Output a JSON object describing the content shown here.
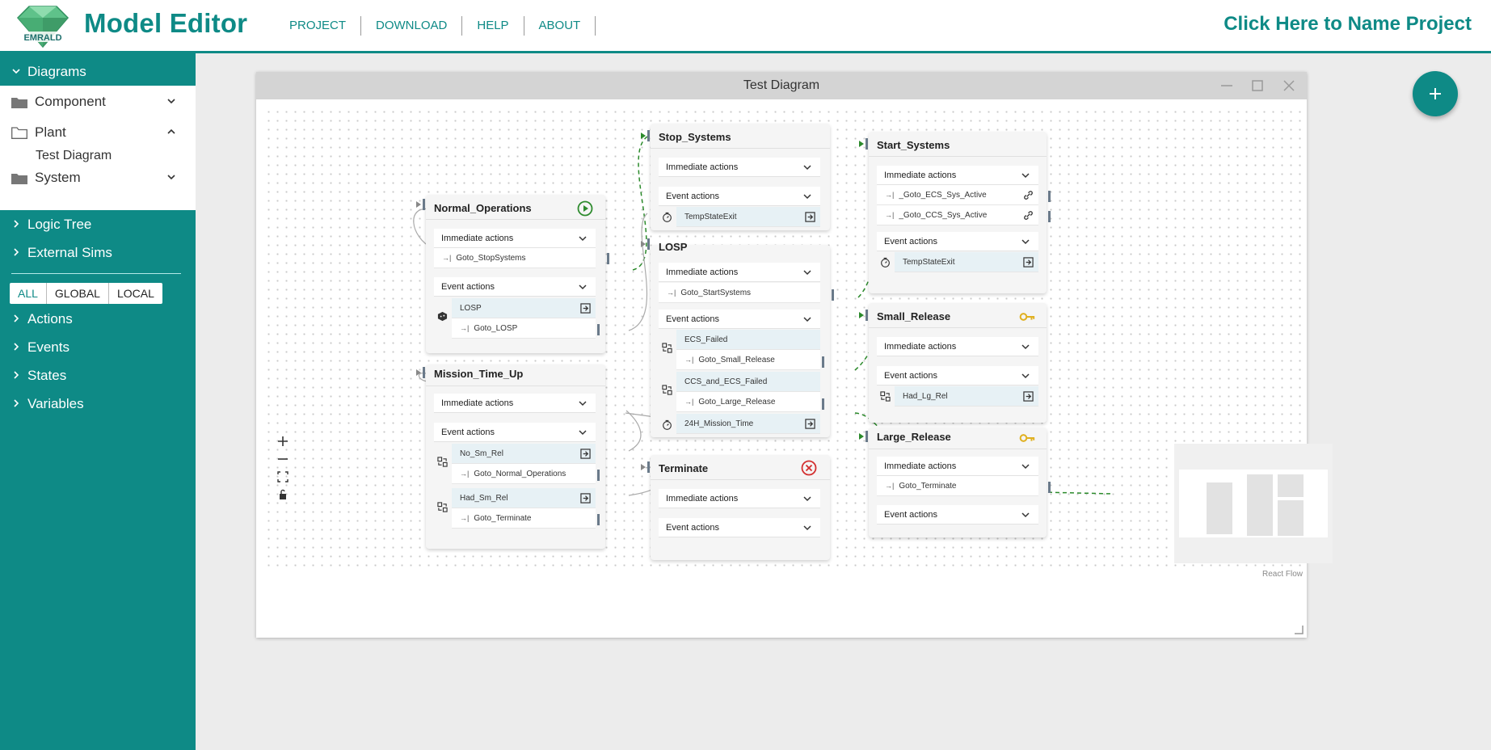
{
  "header": {
    "app_title": "Model Editor",
    "logo_text": "EMRALD",
    "menu": [
      "PROJECT",
      "DOWNLOAD",
      "HELP",
      "ABOUT"
    ],
    "project_name": "Click Here to Name Project"
  },
  "sidebar": {
    "diagrams_label": "Diagrams",
    "folders": [
      {
        "label": "Component",
        "expanded": false
      },
      {
        "label": "Plant",
        "expanded": true,
        "children": [
          "Test Diagram"
        ]
      },
      {
        "label": "System",
        "expanded": false
      }
    ],
    "sections": [
      "Logic Tree",
      "External Sims"
    ],
    "filters": [
      "ALL",
      "GLOBAL",
      "LOCAL"
    ],
    "active_filter": "ALL",
    "lists": [
      "Actions",
      "Events",
      "States",
      "Variables"
    ]
  },
  "window": {
    "title": "Test Diagram",
    "attribution": "React Flow"
  },
  "labels": {
    "immediate": "Immediate actions",
    "event": "Event actions"
  },
  "nodes": {
    "normal_operations": {
      "title": "Normal_Operations",
      "immediate_rows": [
        "Goto_StopSystems"
      ],
      "event_rows": [
        {
          "event": "LOSP",
          "action": "Goto_LOSP"
        }
      ]
    },
    "mission_time_up": {
      "title": "Mission_Time_Up",
      "event_rows": [
        {
          "event": "No_Sm_Rel",
          "action": "Goto_Normal_Operations"
        },
        {
          "event": "Had_Sm_Rel",
          "action": "Goto_Terminate"
        }
      ]
    },
    "stop_systems": {
      "title": "Stop_Systems",
      "event_rows": [
        {
          "event": "TempStateExit"
        }
      ]
    },
    "losp": {
      "title": "LOSP",
      "immediate_rows": [
        "Goto_StartSystems"
      ],
      "event_rows": [
        {
          "event": "ECS_Failed",
          "action": "Goto_Small_Release"
        },
        {
          "event": "CCS_and_ECS_Failed",
          "action": "Goto_Large_Release"
        },
        {
          "event": "24H_Mission_Time"
        }
      ]
    },
    "terminate": {
      "title": "Terminate"
    },
    "start_systems": {
      "title": "Start_Systems",
      "immediate_rows": [
        "_Goto_ECS_Sys_Active",
        "_Goto_CCS_Sys_Active"
      ],
      "event_rows": [
        {
          "event": "TempStateExit"
        }
      ]
    },
    "small_release": {
      "title": "Small_Release",
      "event_rows": [
        {
          "event": "Had_Lg_Rel"
        }
      ]
    },
    "large_release": {
      "title": "Large_Release",
      "immediate_rows": [
        "Goto_Terminate"
      ]
    }
  },
  "colors": {
    "brand": "#0e8a86",
    "start": "#2e8b2e",
    "terminal": "#d32f2f",
    "key": "#e0b020",
    "edge_green": "#2a8a2a",
    "edge_gray": "#9a9a9a"
  }
}
